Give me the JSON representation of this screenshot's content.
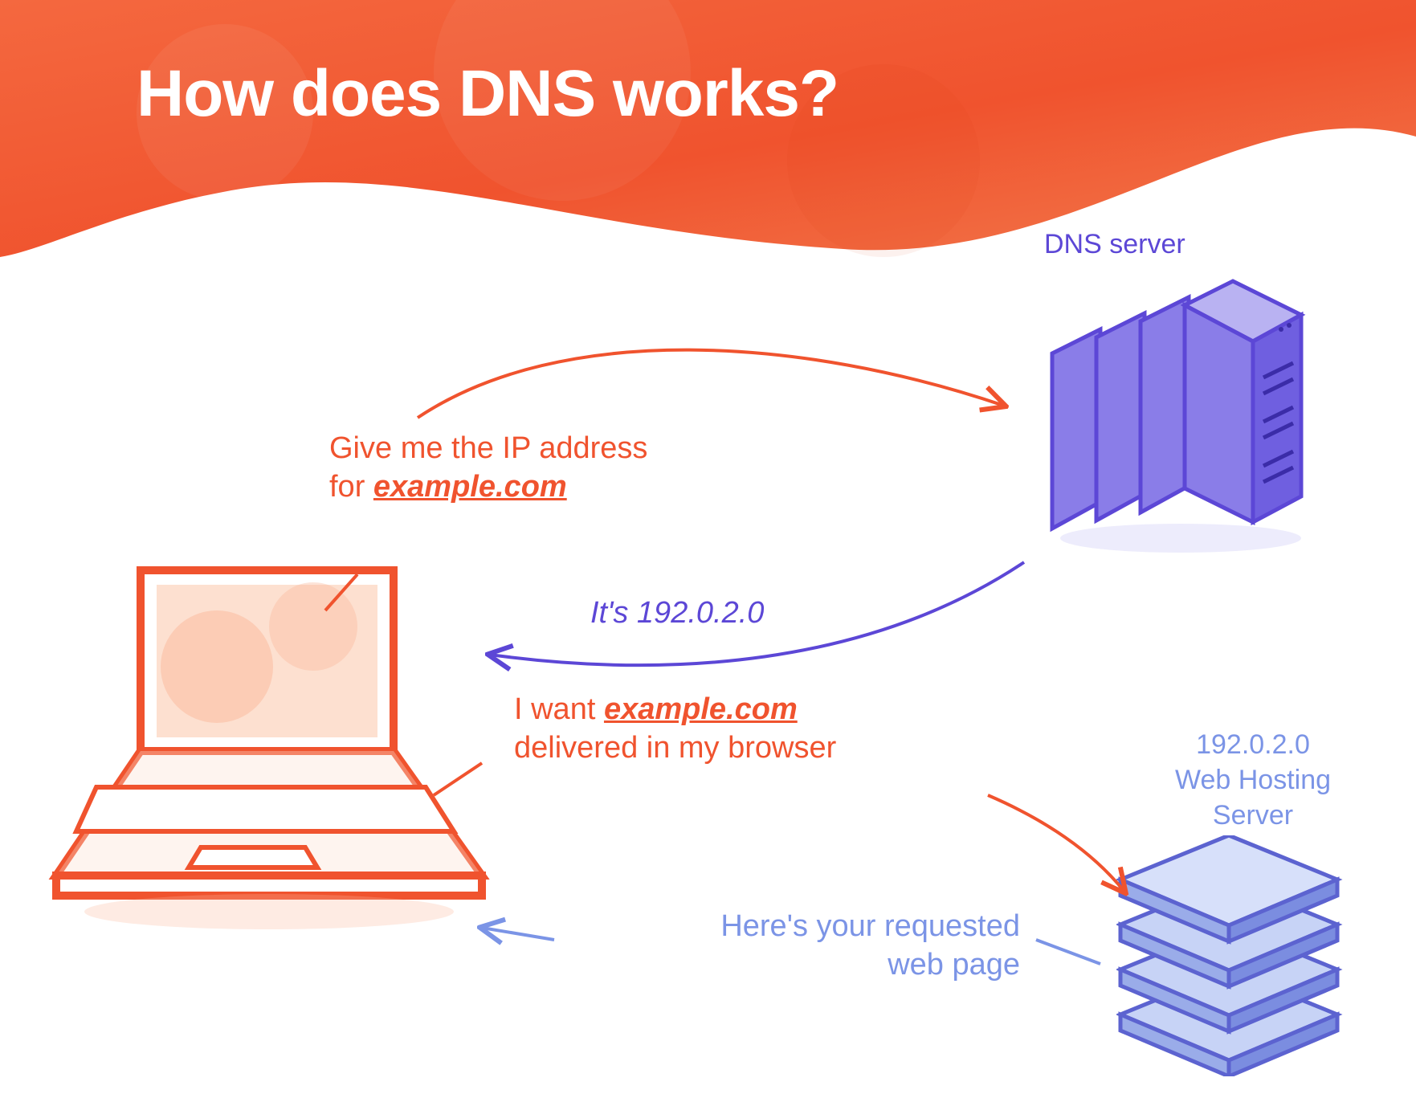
{
  "title": "How does DNS works?",
  "labels": {
    "dns_server": "DNS server",
    "web_server_line1": "192.0.2.0",
    "web_server_line2": "Web Hosting",
    "web_server_line3": "Server"
  },
  "steps": {
    "request_dns_line1": "Give me the IP address",
    "request_dns_line2_prefix": "for ",
    "request_dns_domain": "example.com",
    "response_dns": "It's 192.0.2.0",
    "request_web_line1_prefix": "I want ",
    "request_web_domain": "example.com",
    "request_web_line2": "delivered in my browser",
    "response_web_line1": "Here's your requested",
    "response_web_line2": "web page"
  },
  "colors": {
    "orange": "#f0532e",
    "orange_light": "#fbb89a",
    "purple": "#5c47d6",
    "purple_mid": "#8a7de8",
    "purple_light": "#b9b2f2",
    "blue": "#7b94e6",
    "blue_light": "#b8c6f2"
  }
}
